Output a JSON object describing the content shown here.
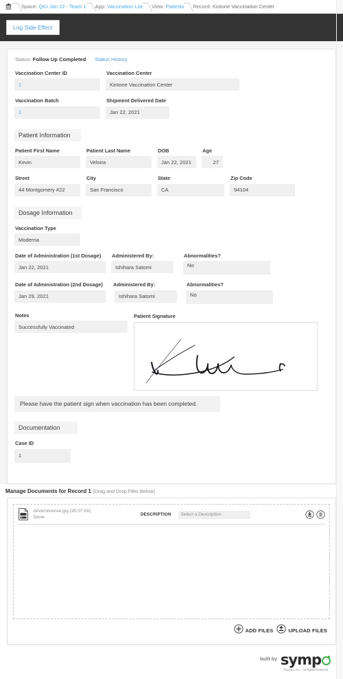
{
  "breadcrumb": {
    "home_icon": "home-icon",
    "items": [
      {
        "label": "Space:",
        "value": "QIU Jan 22 - Team 1",
        "link": true
      },
      {
        "label": "App:",
        "value": "Vaccination List",
        "link": true
      },
      {
        "label": "View:",
        "value": "Patients",
        "link": true
      },
      {
        "label": "Record:",
        "value": "Kintone Vaccination Center",
        "link": false
      }
    ]
  },
  "toolbar": {
    "log_side_effect_label": "Log Side Effect",
    "bar_color": "#333333",
    "link_color": "#4a9ad4"
  },
  "record": {
    "status_prefix": "Status:",
    "status_value": "Follow Up Completed",
    "status_history_label": "Status History",
    "vaccination_center_id": {
      "label": "Vaccination Center ID",
      "value": "1"
    },
    "vaccination_center": {
      "label": "Vaccination Center",
      "value": "Kintone Vaccination Center"
    },
    "vaccination_batch": {
      "label": "Vaccination Batch",
      "value": "1"
    },
    "shipment_delivered_date": {
      "label": "Shipment Delivered Date",
      "value": "Jan 22, 2021"
    }
  },
  "patient_information": {
    "section_title": "Patient Information",
    "first_name": {
      "label": "Patient First Name",
      "value": "Kevin"
    },
    "last_name": {
      "label": "Patient Last Name",
      "value": "Veloira"
    },
    "dob": {
      "label": "DOB",
      "value": "Jan 22, 2021"
    },
    "age": {
      "label": "Age",
      "value": "27"
    },
    "street": {
      "label": "Street",
      "value": "44 Montgomery #22"
    },
    "city": {
      "label": "City",
      "value": "San Francisco"
    },
    "state": {
      "label": "State",
      "value": "CA"
    },
    "zip": {
      "label": "Zip Code",
      "value": "94104"
    }
  },
  "dosage_information": {
    "section_title": "Dosage Information",
    "vaccination_type": {
      "label": "Vaccination Type",
      "value": "Moderna"
    },
    "dose1": {
      "date_label": "Date of Administration (1st Dosage)",
      "date_value": "Jan 22, 2021",
      "admin_label": "Administered By:",
      "admin_value": "Ishihara Satomi",
      "abnormal_label": "Abnormalities?",
      "abnormal_value": "No"
    },
    "dose2": {
      "date_label": "Date of Administration (2nd Dosage)",
      "date_value": "Jan 29, 2021",
      "admin_label": "Administered By:",
      "admin_value": "Ishihara Satomi",
      "abnormal_label": "Abnormalities?",
      "abnormal_value": "No"
    },
    "notes": {
      "label": "Notes",
      "value": "Successfully Vaccinated"
    },
    "signature": {
      "label": "Patient Signature"
    },
    "helper_text": "Please have the patient sign when vaccination has been completed."
  },
  "documentation": {
    "section_title": "Documentation",
    "case_id": {
      "label": "Case ID",
      "value": "1"
    }
  },
  "documents": {
    "title_main": "Manage Documents for Record",
    "title_record_number": "1",
    "title_sub": "(Drag and Drop Files Below)",
    "files": [
      {
        "icon": "file-image-icon",
        "name": "driverslicense.jpg (35.07 Kb)",
        "state": "Done",
        "description_label": "DESCRIPTION",
        "description_placeholder": "Select a Description",
        "download_icon": "download-icon",
        "delete_icon": "trash-icon"
      }
    ],
    "add_files_label": "ADD FILES",
    "add_files_icon": "plus-circle-icon",
    "upload_files_label": "UPLOAD FILES",
    "upload_files_icon": "upload-circle-icon"
  },
  "footer": {
    "built_by": "built by",
    "logo_text": "symp",
    "logo_accent_color": "#3fae49",
    "copyright": "©Sympo, Inc. - All Rights Reserved"
  }
}
